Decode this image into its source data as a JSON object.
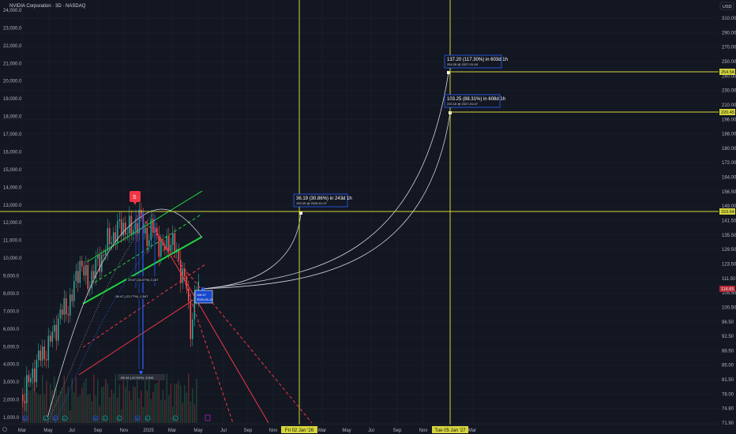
{
  "header": {
    "title": "NVIDIA Corporation · 3D · NASDAQ"
  },
  "currency_button": "USD",
  "colors": {
    "background": "#131722",
    "grid": "#1e222d",
    "axis_text": "#b2b5be",
    "vertical_line": "#d4d43a",
    "horizontal_line": "#d4d43a",
    "green_channel": "#22d13f",
    "red_channel": "#f23645",
    "blue_annotation": "#2962ff",
    "curve": "#d1d4dc",
    "price_badge": "#b22833"
  },
  "chart_data": {
    "type": "line",
    "title": "NVIDIA Corporation · 3D · NASDAQ",
    "x_axis": {
      "ticks": [
        "Mar",
        "May",
        "Jul",
        "Sep",
        "Nov",
        "2025",
        "Mar",
        "May",
        "Jul",
        "Sep",
        "Nov",
        "Fri 02 Jan '26",
        "Mar",
        "May",
        "Jul",
        "Sep",
        "Nov",
        "Tue 05 Jan '27",
        "Mar"
      ]
    },
    "left_axis": {
      "label": "volume",
      "ticks": [
        "24,000.0",
        "23,000.0",
        "22,000.0",
        "21,000.0",
        "20,000.0",
        "19,000.0",
        "18,000.0",
        "17,000.0",
        "16,000.0",
        "15,000.0",
        "14,000.0",
        "13,000.0",
        "12,000.0",
        "11,000.0",
        "10,000.0",
        "9,000.0",
        "8,000.0",
        "7,000.0",
        "6,000.0",
        "5,000.0",
        "4,000.0",
        "3,000.0",
        "2,000.0",
        "1,000.0"
      ]
    },
    "right_axis": {
      "scale": "log",
      "ticks": [
        "310.00",
        "290.00",
        "270.00",
        "250.00",
        "240.00",
        "230.00",
        "210.00",
        "196.00",
        "188.00",
        "180.00",
        "172.00",
        "164.00",
        "156.50",
        "149.00",
        "141.50",
        "135.50",
        "129.50",
        "123.50",
        "111.50",
        "105.50",
        "100.50",
        "96.50",
        "92.50",
        "88.50",
        "85.00",
        "81.50",
        "78.00",
        "74.80",
        "71.90"
      ]
    },
    "price_tags": [
      {
        "value": "254.54",
        "style": "yellow"
      },
      {
        "value": "220.45",
        "style": "yellow"
      },
      {
        "value": "153.64",
        "style": "yellow"
      },
      {
        "value": "116.65",
        "style": "red"
      }
    ],
    "vertical_markers": [
      "Fri 02 Jan '26",
      "Tue 05 Jan '27"
    ],
    "measurements": [
      {
        "main": "137.20 (117.30%) in 603d 1h",
        "sub": "254.26 @ 2027-01-04"
      },
      {
        "main": "103.25 (88.31%) in 608d 1h",
        "sub": "220.16 @ 2027-01-07"
      },
      {
        "main": "36.19 (30.86%) in 243d 1h",
        "sub": "153.49 @ 2026-01-07"
      }
    ],
    "channel_labels": [
      "29.67 (34.07%) 2,167",
      "-36.47 (-23.77%) -1,547",
      "-65.44 (-42.94%) -6,544"
    ],
    "position_box": {
      "line1": "116.6?",
      "line2": "2025-05-15"
    },
    "event_icon": "S",
    "timeline_markers": [
      "D",
      "E",
      "D",
      "E",
      "D",
      "E",
      "E",
      "D",
      "E",
      "E"
    ]
  }
}
